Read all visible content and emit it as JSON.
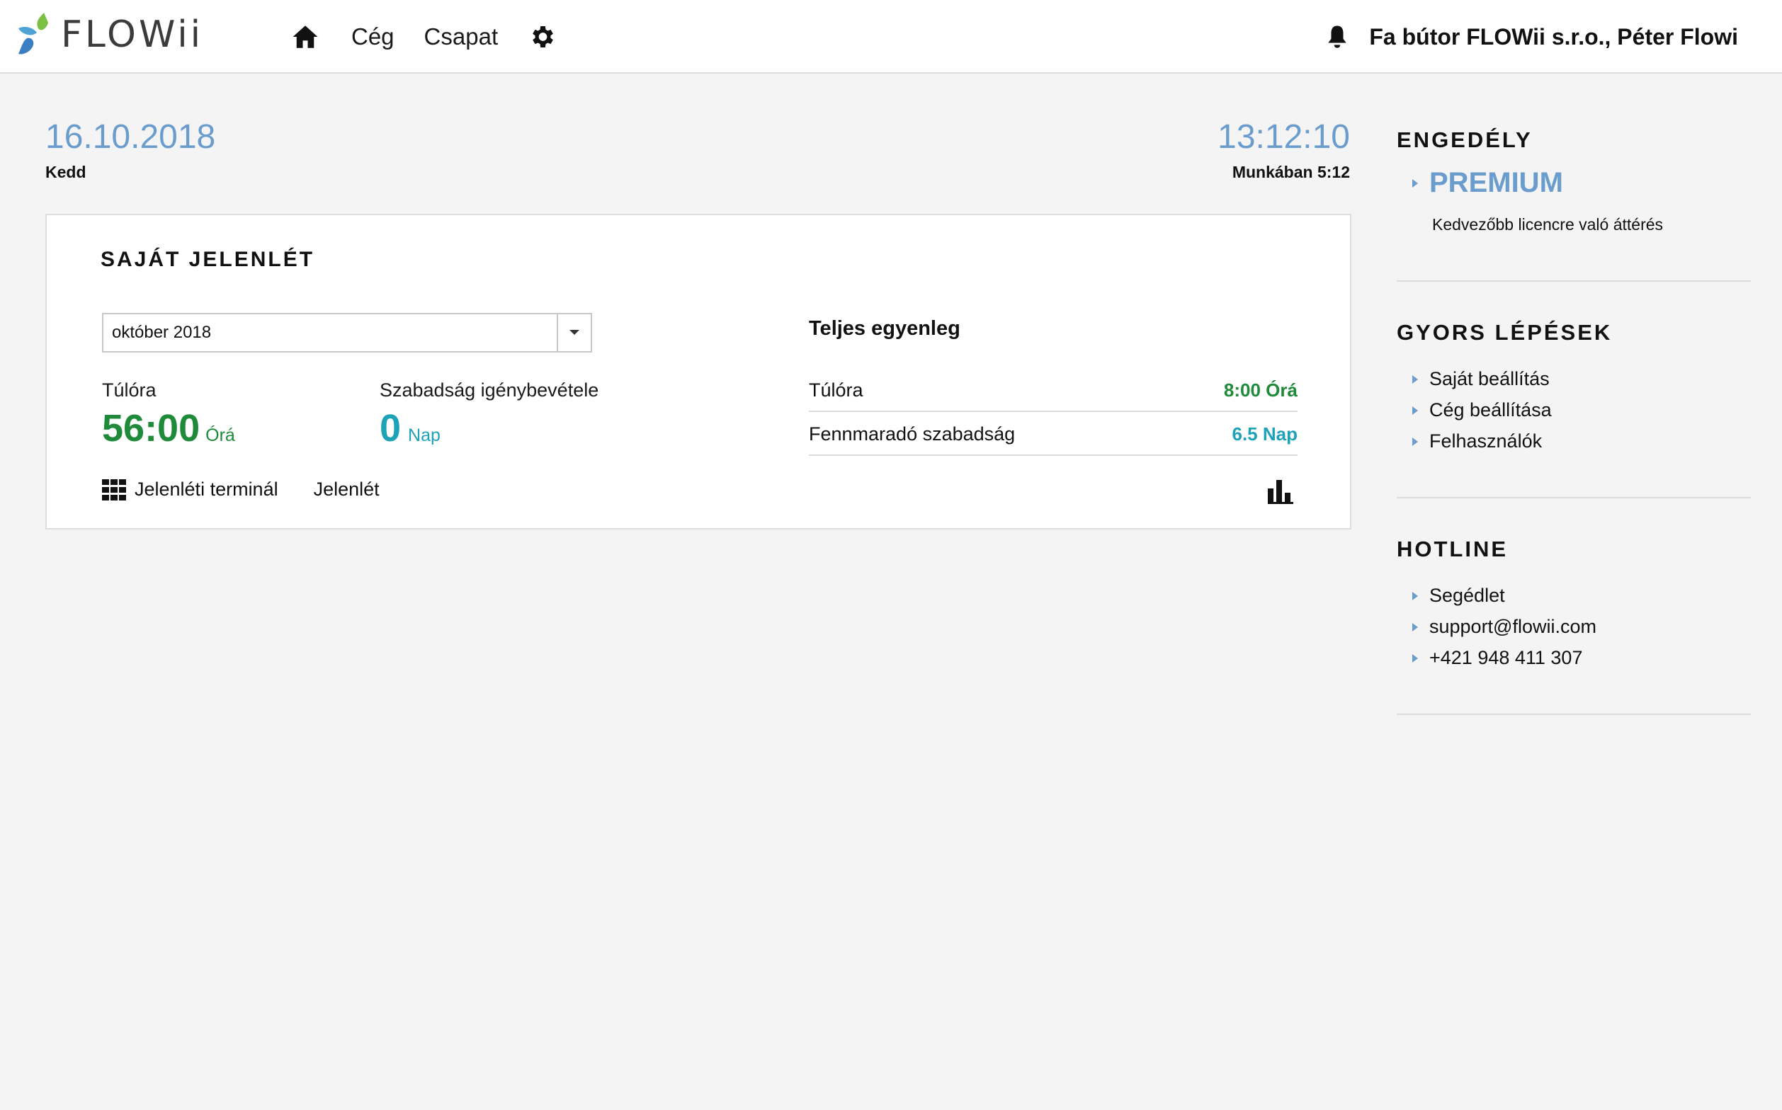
{
  "header": {
    "logo_text": "FLOWii",
    "nav": {
      "company": "Cég",
      "team": "Csapat"
    },
    "user": "Fa bútor FLOWii s.r.o., Péter Flowi"
  },
  "datetime": {
    "date": "16.10.2018",
    "day": "Kedd",
    "time": "13:12:10",
    "working": "Munkában 5:12"
  },
  "attendance": {
    "title": "SAJÁT JELENLÉT",
    "month_select": "október 2018",
    "overtime_label": "Túlóra",
    "overtime_value": "56:00",
    "overtime_unit": "Órá",
    "leave_label": "Szabadság igénybevétele",
    "leave_value": "0",
    "leave_unit": "Nap",
    "link_terminal": "Jelenléti terminál",
    "link_attendance": "Jelenlét",
    "balance_title": "Teljes egyenleg",
    "balance": [
      {
        "label": "Túlóra",
        "value": "8:00 Órá"
      },
      {
        "label": "Fennmaradó szabadság",
        "value": "6.5 Nap"
      }
    ]
  },
  "sidebar": {
    "license": {
      "title": "ENGEDÉLY",
      "plan": "PREMIUM",
      "upgrade": "Kedvezőbb licencre való áttérés"
    },
    "quick": {
      "title": "GYORS LÉPÉSEK",
      "items": [
        "Saját beállítás",
        "Cég beállítása",
        "Felhasználók"
      ]
    },
    "hotline": {
      "title": "HOTLINE",
      "items": [
        "Segédlet",
        "support@flowii.com",
        "+421 948 411 307"
      ]
    }
  },
  "colors": {
    "accent_blue": "#6a9ccd",
    "green": "#1f8b3a",
    "teal": "#1ea2b8"
  },
  "icons": [
    "logo-drops-icon",
    "home-icon",
    "gear-icon",
    "bell-icon",
    "chevron-down-icon",
    "grid-icon",
    "bar-chart-icon",
    "bullet-triangle-icon"
  ]
}
